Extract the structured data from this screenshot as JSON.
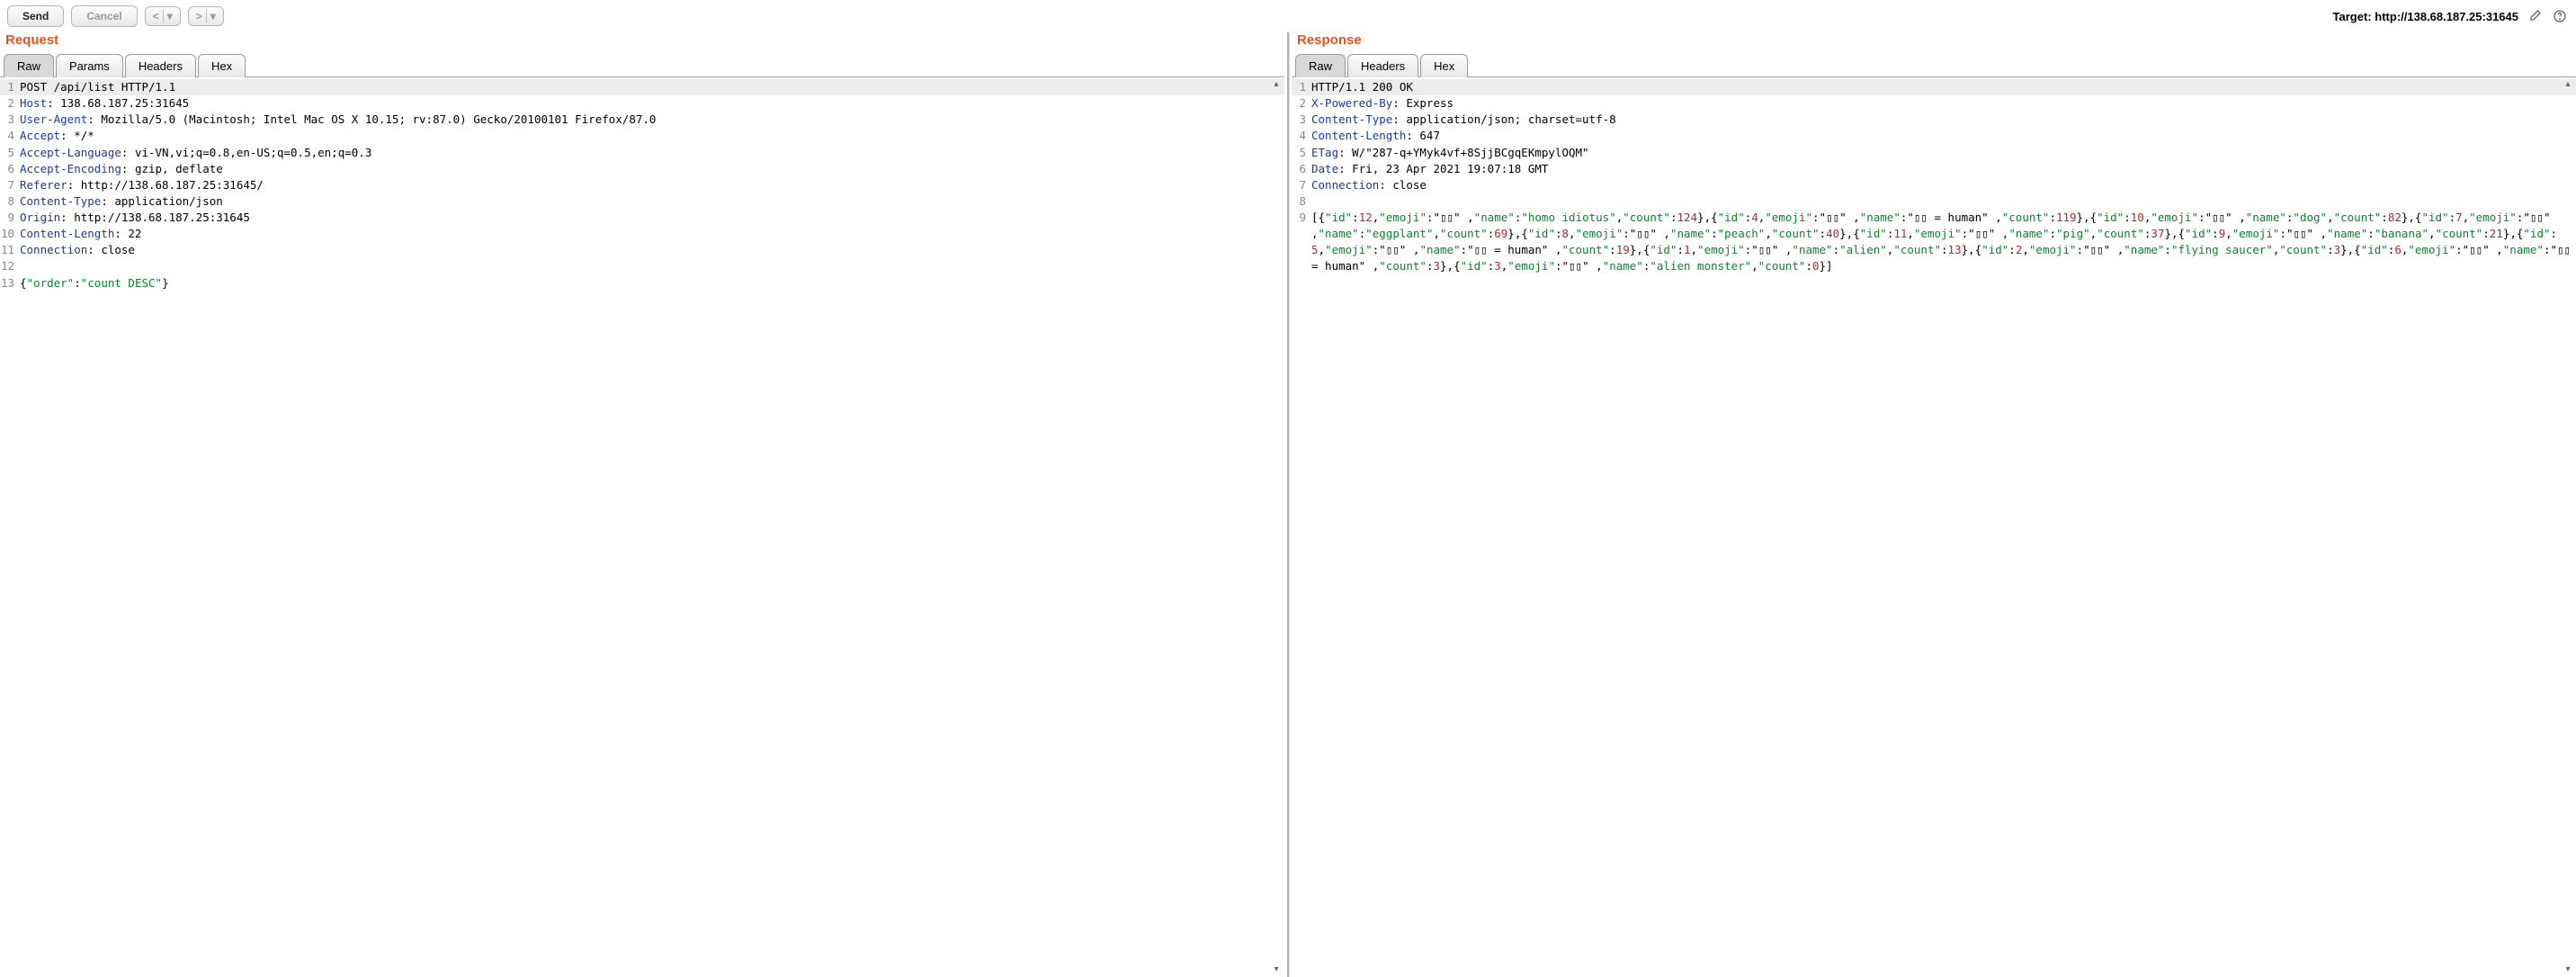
{
  "toolbar": {
    "send_label": "Send",
    "cancel_label": "Cancel",
    "prev_glyph": "<",
    "next_glyph": ">",
    "dropdown_glyph": "▾",
    "target_label": "Target:",
    "target_value": "http://138.68.187.25:31645"
  },
  "request": {
    "title": "Request",
    "tabs": [
      "Raw",
      "Params",
      "Headers",
      "Hex"
    ],
    "active_tab": "Raw",
    "lines": [
      {
        "n": "1",
        "html": "POST /api/list HTTP/1.1",
        "firstline": true
      },
      {
        "n": "2",
        "html": "<span class='k'>Host</span>: 138.68.187.25:31645"
      },
      {
        "n": "3",
        "html": "<span class='k'>User-Agent</span>: Mozilla/5.0 (Macintosh; Intel Mac OS X 10.15; rv:87.0) Gecko/20100101 Firefox/87.0"
      },
      {
        "n": "4",
        "html": "<span class='k'>Accept</span>: */*"
      },
      {
        "n": "5",
        "html": "<span class='k'>Accept-Language</span>: vi-VN,vi;q=0.8,en-US;q=0.5,en;q=0.3"
      },
      {
        "n": "6",
        "html": "<span class='k'>Accept-Encoding</span>: gzip, deflate"
      },
      {
        "n": "7",
        "html": "<span class='k'>Referer</span>: http://138.68.187.25:31645/"
      },
      {
        "n": "8",
        "html": "<span class='k'>Content-Type</span>: application/json"
      },
      {
        "n": "9",
        "html": "<span class='k'>Origin</span>: http://138.68.187.25:31645"
      },
      {
        "n": "10",
        "html": "<span class='k'>Content-Length</span>: 22"
      },
      {
        "n": "11",
        "html": "<span class='k'>Connection</span>: close"
      },
      {
        "n": "12",
        "html": ""
      },
      {
        "n": "13",
        "html": "{<span class='s'>\"order\"</span>:<span class='s'>\"count DESC\"</span>}"
      }
    ]
  },
  "response": {
    "title": "Response",
    "tabs": [
      "Raw",
      "Headers",
      "Hex"
    ],
    "active_tab": "Raw",
    "lines": [
      {
        "n": "1",
        "html": "HTTP/1.1 200 OK",
        "firstline": true
      },
      {
        "n": "2",
        "html": "<span class='k'>X-Powered-By</span>: Express"
      },
      {
        "n": "3",
        "html": "<span class='k'>Content-Type</span>: application/json; charset=utf-8"
      },
      {
        "n": "4",
        "html": "<span class='k'>Content-Length</span>: 647"
      },
      {
        "n": "5",
        "html": "<span class='k'>ETag</span>: W/\"287-q+YMyk4vf+8SjjBCgqEKmpylOQM\""
      },
      {
        "n": "6",
        "html": "<span class='k'>Date</span>: Fri, 23 Apr 2021 19:07:18 GMT"
      },
      {
        "n": "7",
        "html": "<span class='k'>Connection</span>: close"
      },
      {
        "n": "8",
        "html": ""
      },
      {
        "n": "9",
        "html": "[{<span class='s'>\"id\"</span>:<span class='n'>12</span>,<span class='s'>\"emoji\"</span>:\"▯▯\" ,<span class='s'>\"name\"</span>:<span class='s'>\"homo idiotus\"</span>,<span class='s'>\"count\"</span>:<span class='n'>124</span>},{<span class='s'>\"id\"</span>:<span class='n'>4</span>,<span class='s'>\"emoji\"</span>:\"▯▯\" ,<span class='s'>\"name\"</span>:\"▯▯ = human\" ,<span class='s'>\"count\"</span>:<span class='n'>119</span>},{<span class='s'>\"id\"</span>:<span class='n'>10</span>,<span class='s'>\"emoji\"</span>:\"▯▯\" ,<span class='s'>\"name\"</span>:<span class='s'>\"dog\"</span>,<span class='s'>\"count\"</span>:<span class='n'>82</span>},{<span class='s'>\"id\"</span>:<span class='n'>7</span>,<span class='s'>\"emoji\"</span>:\"▯▯\" ,<span class='s'>\"name\"</span>:<span class='s'>\"eggplant\"</span>,<span class='s'>\"count\"</span>:<span class='n'>69</span>},{<span class='s'>\"id\"</span>:<span class='n'>8</span>,<span class='s'>\"emoji\"</span>:\"▯▯\" ,<span class='s'>\"name\"</span>:<span class='s'>\"peach\"</span>,<span class='s'>\"count\"</span>:<span class='n'>40</span>},{<span class='s'>\"id\"</span>:<span class='n'>11</span>,<span class='s'>\"emoji\"</span>:\"▯▯\" ,<span class='s'>\"name\"</span>:<span class='s'>\"pig\"</span>,<span class='s'>\"count\"</span>:<span class='n'>37</span>},{<span class='s'>\"id\"</span>:<span class='n'>9</span>,<span class='s'>\"emoji\"</span>:\"▯▯\" ,<span class='s'>\"name\"</span>:<span class='s'>\"banana\"</span>,<span class='s'>\"count\"</span>:<span class='n'>21</span>},{<span class='s'>\"id\"</span>:<span class='n'>5</span>,<span class='s'>\"emoji\"</span>:\"▯▯\" ,<span class='s'>\"name\"</span>:\"▯▯ = human\" ,<span class='s'>\"count\"</span>:<span class='n'>19</span>},{<span class='s'>\"id\"</span>:<span class='n'>1</span>,<span class='s'>\"emoji\"</span>:\"▯▯\" ,<span class='s'>\"name\"</span>:<span class='s'>\"alien\"</span>,<span class='s'>\"count\"</span>:<span class='n'>13</span>},{<span class='s'>\"id\"</span>:<span class='n'>2</span>,<span class='s'>\"emoji\"</span>:\"▯▯\" ,<span class='s'>\"name\"</span>:<span class='s'>\"flying saucer\"</span>,<span class='s'>\"count\"</span>:<span class='n'>3</span>},{<span class='s'>\"id\"</span>:<span class='n'>6</span>,<span class='s'>\"emoji\"</span>:\"▯▯\" ,<span class='s'>\"name\"</span>:\"▯▯ = human\" ,<span class='s'>\"count\"</span>:<span class='n'>3</span>},{<span class='s'>\"id\"</span>:<span class='n'>3</span>,<span class='s'>\"emoji\"</span>:\"▯▯\" ,<span class='s'>\"name\"</span>:<span class='s'>\"alien monster\"</span>,<span class='s'>\"count\"</span>:<span class='n'>0</span>}]"
      }
    ]
  }
}
